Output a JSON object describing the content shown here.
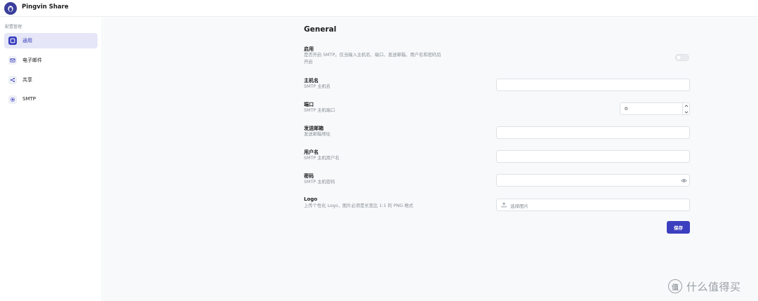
{
  "app": {
    "title": "Pingvin Share"
  },
  "sidebar": {
    "section_label": "配置管理",
    "items": [
      {
        "label": "通用",
        "icon": "square-icon",
        "active": true
      },
      {
        "label": "电子邮件",
        "icon": "mail-icon",
        "active": false
      },
      {
        "label": "共享",
        "icon": "share-icon",
        "active": false
      },
      {
        "label": "SMTP",
        "icon": "gear-icon",
        "active": false
      }
    ]
  },
  "main": {
    "section_title": "General",
    "enable": {
      "label": "启用",
      "desc_line1": "是否开启 SMTP。仅当输入主机名、端口、发送邮箱、用户名和密码后",
      "desc_line2": "开启",
      "toggle_on": false
    },
    "hostname": {
      "label": "主机名",
      "desc": "SMTP 主机名",
      "value": ""
    },
    "port": {
      "label": "端口",
      "desc": "SMTP 主机端口",
      "value": "0"
    },
    "sender": {
      "label": "发送邮箱",
      "desc": "发送邮箱地址",
      "value": ""
    },
    "username": {
      "label": "用户名",
      "desc": "SMTP 主机用户名",
      "value": ""
    },
    "password": {
      "label": "密码",
      "desc": "SMTP 主机密码",
      "value": ""
    },
    "logo": {
      "label": "Logo",
      "desc": "上传个性化 Logo，图片必须是长宽比 1:1 的 PNG 格式",
      "placeholder": "选择图片"
    },
    "save_label": "保存"
  },
  "watermark": {
    "badge": "值",
    "text": "什么值得买"
  },
  "colors": {
    "accent": "#3b3fbf",
    "logo_bg": "#3b3f9c",
    "active_bg": "#e5e6f7",
    "page_bg": "#f8f9fa"
  }
}
